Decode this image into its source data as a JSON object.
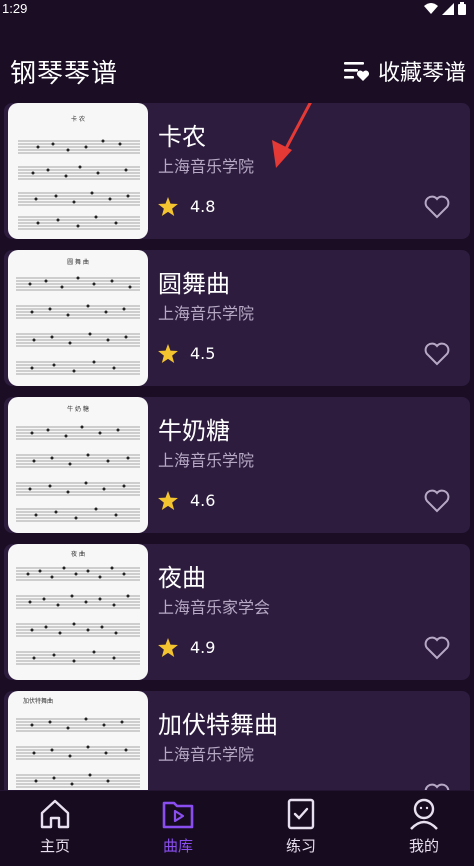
{
  "status": {
    "time": "1:29"
  },
  "header": {
    "title": "钢琴琴谱",
    "fav_label": "收藏琴谱"
  },
  "pieces": [
    {
      "title": "卡农",
      "source": "上海音乐学院",
      "rating": "4.8",
      "sheet_title": "卡 农"
    },
    {
      "title": "圆舞曲",
      "source": "上海音乐学院",
      "rating": "4.5",
      "sheet_title": "圆 舞 曲"
    },
    {
      "title": "牛奶糖",
      "source": "上海音乐学院",
      "rating": "4.6",
      "sheet_title": "牛 奶 糖"
    },
    {
      "title": "夜曲",
      "source": "上海音乐家学会",
      "rating": "4.9",
      "sheet_title": "夜 曲"
    },
    {
      "title": "加伏特舞曲",
      "source": "上海音乐学院",
      "rating": "",
      "sheet_title": "加伏特舞曲"
    }
  ],
  "nav": [
    {
      "label": "主页",
      "icon": "home-icon"
    },
    {
      "label": "曲库",
      "icon": "library-play-icon",
      "active": true
    },
    {
      "label": "练习",
      "icon": "checklist-icon"
    },
    {
      "label": "我的",
      "icon": "profile-icon"
    }
  ],
  "colors": {
    "accent": "#8a4ef0",
    "star": "#f4c430",
    "card": "#2d1c3e",
    "background": "#1a0d24",
    "arrow": "#e53935"
  }
}
